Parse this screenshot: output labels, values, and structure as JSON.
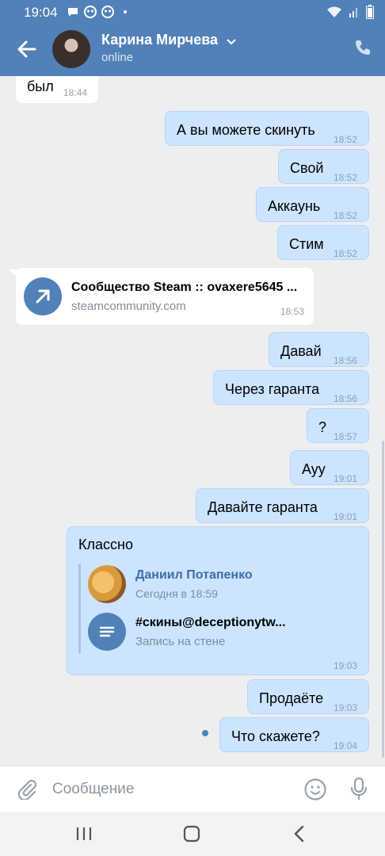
{
  "status_bar": {
    "time": "19:04"
  },
  "header": {
    "name": "Карина Мирчева",
    "status": "online"
  },
  "messages": [
    {
      "text": "был",
      "time": "18:44"
    },
    {
      "text": "А вы можете скинуть",
      "time": "18:52"
    },
    {
      "text": "Свой",
      "time": "18:52"
    },
    {
      "text": "Аккаунь",
      "time": "18:52"
    },
    {
      "text": "Стим",
      "time": "18:52"
    },
    {
      "text": "Давай",
      "time": "18:56"
    },
    {
      "text": "Через гаранта",
      "time": "18:56"
    },
    {
      "text": "?",
      "time": "18:57"
    },
    {
      "text": "Ауу",
      "time": "19:01"
    },
    {
      "text": "Давайте гаранта",
      "time": "19:01"
    },
    {
      "text": "Продаёте",
      "time": "19:03"
    },
    {
      "text": "Что скажете?",
      "time": "19:04"
    }
  ],
  "link": {
    "title": "Сообщество Steam :: ovaxere5645 ...",
    "url": "steamcommunity.com",
    "time": "18:53"
  },
  "forwarded": {
    "text": "Классно",
    "author": "Даниил Потапенко",
    "date": "Сегодня в 18:59",
    "wall_title": "#скины@deceptionytw...",
    "wall_sub": "Запись на стене",
    "time": "19:03"
  },
  "input": {
    "placeholder": "Сообщение"
  },
  "colors": {
    "header": "#5181b8",
    "outgoing": "#cce4ff",
    "incoming": "#ffffff",
    "background": "#edeef0"
  }
}
